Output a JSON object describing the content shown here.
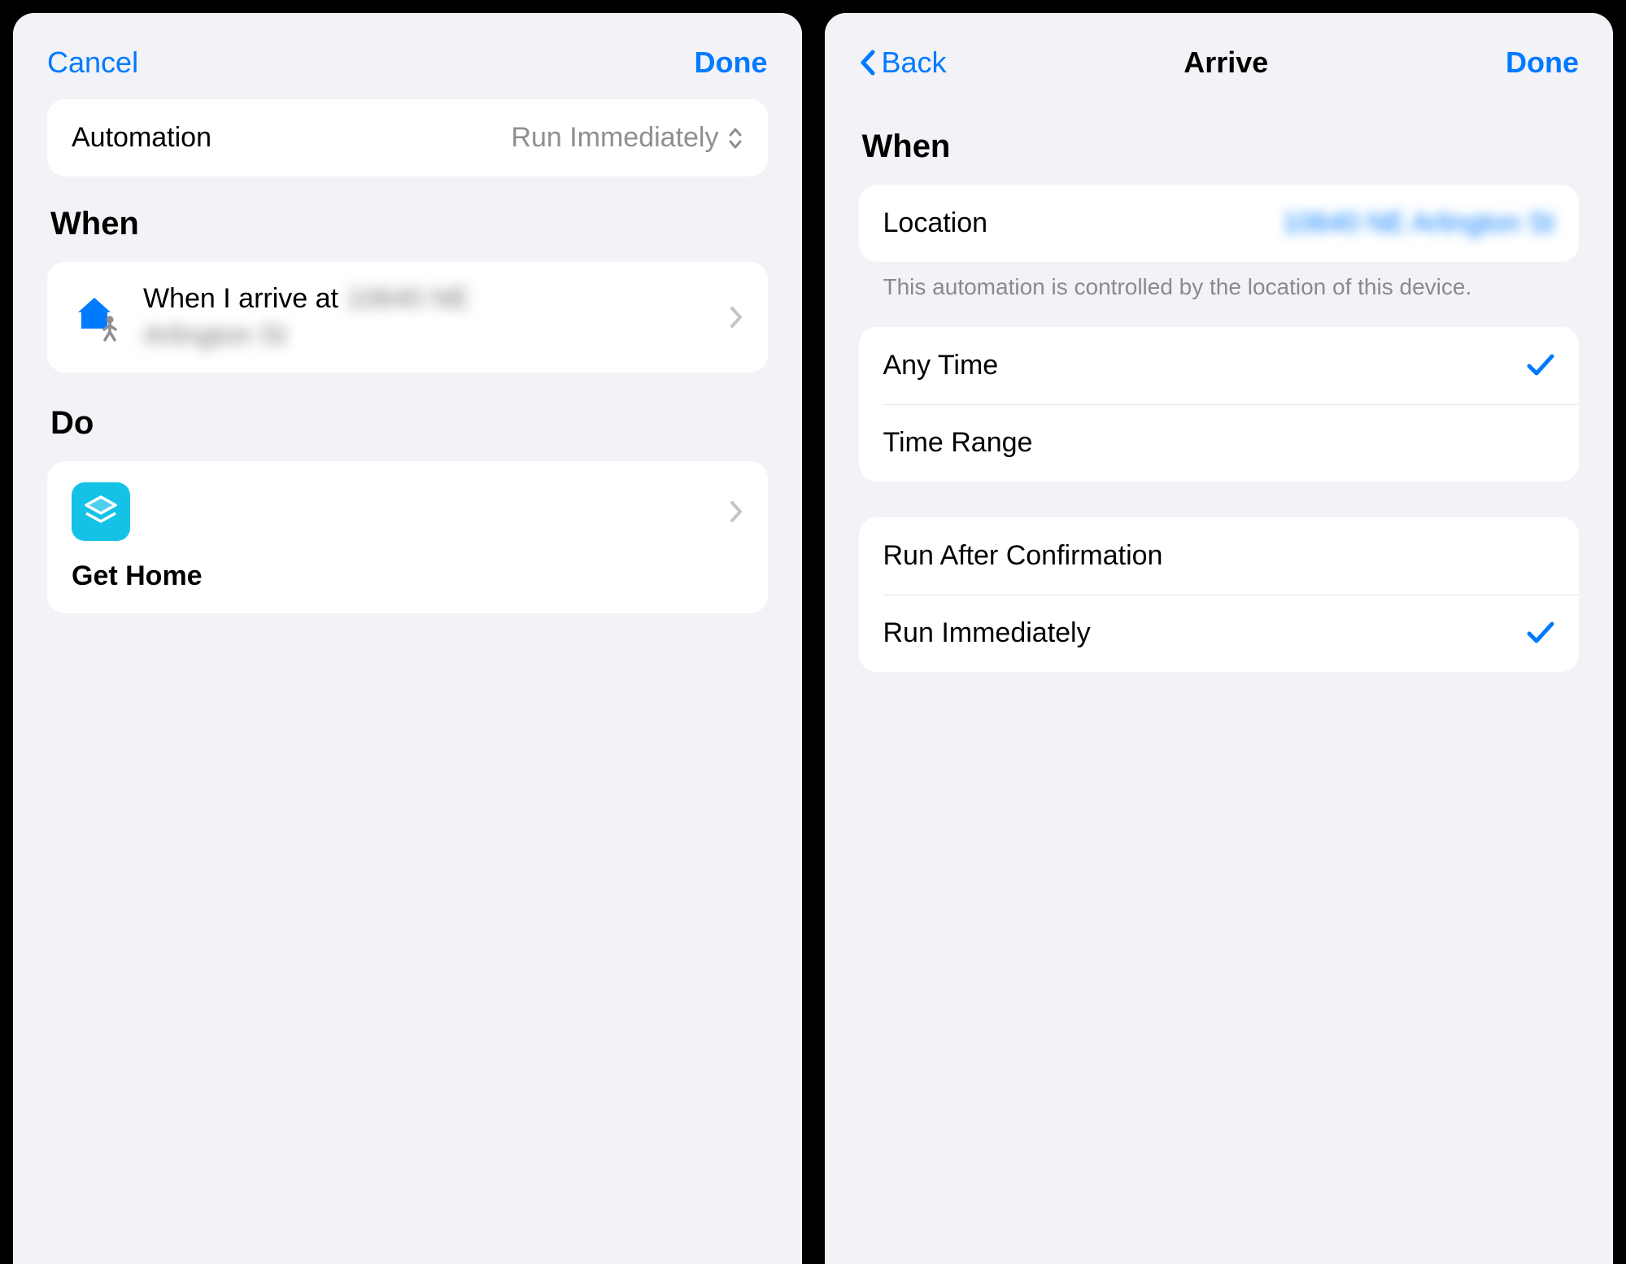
{
  "left": {
    "nav": {
      "cancel": "Cancel",
      "done": "Done"
    },
    "automation_label": "Automation",
    "automation_value": "Run Immediately",
    "section_when": "When",
    "arrive_prefix": "When I arrive at",
    "arrive_addr_line1": "10640 NE",
    "arrive_addr_line2": "Arlington St",
    "section_do": "Do",
    "shortcut_name": "Get Home"
  },
  "right": {
    "nav": {
      "back": "Back",
      "title": "Arrive",
      "done": "Done"
    },
    "section_when": "When",
    "location_label": "Location",
    "location_value": "10640 NE Arlington St",
    "location_note": "This automation is controlled by the location of this device.",
    "time_options": [
      {
        "label": "Any Time",
        "selected": true
      },
      {
        "label": "Time Range",
        "selected": false
      }
    ],
    "run_options": [
      {
        "label": "Run After Confirmation",
        "selected": false
      },
      {
        "label": "Run Immediately",
        "selected": true
      }
    ]
  },
  "colors": {
    "accent": "#007aff",
    "shortcut_bg": "#14c2e7"
  }
}
